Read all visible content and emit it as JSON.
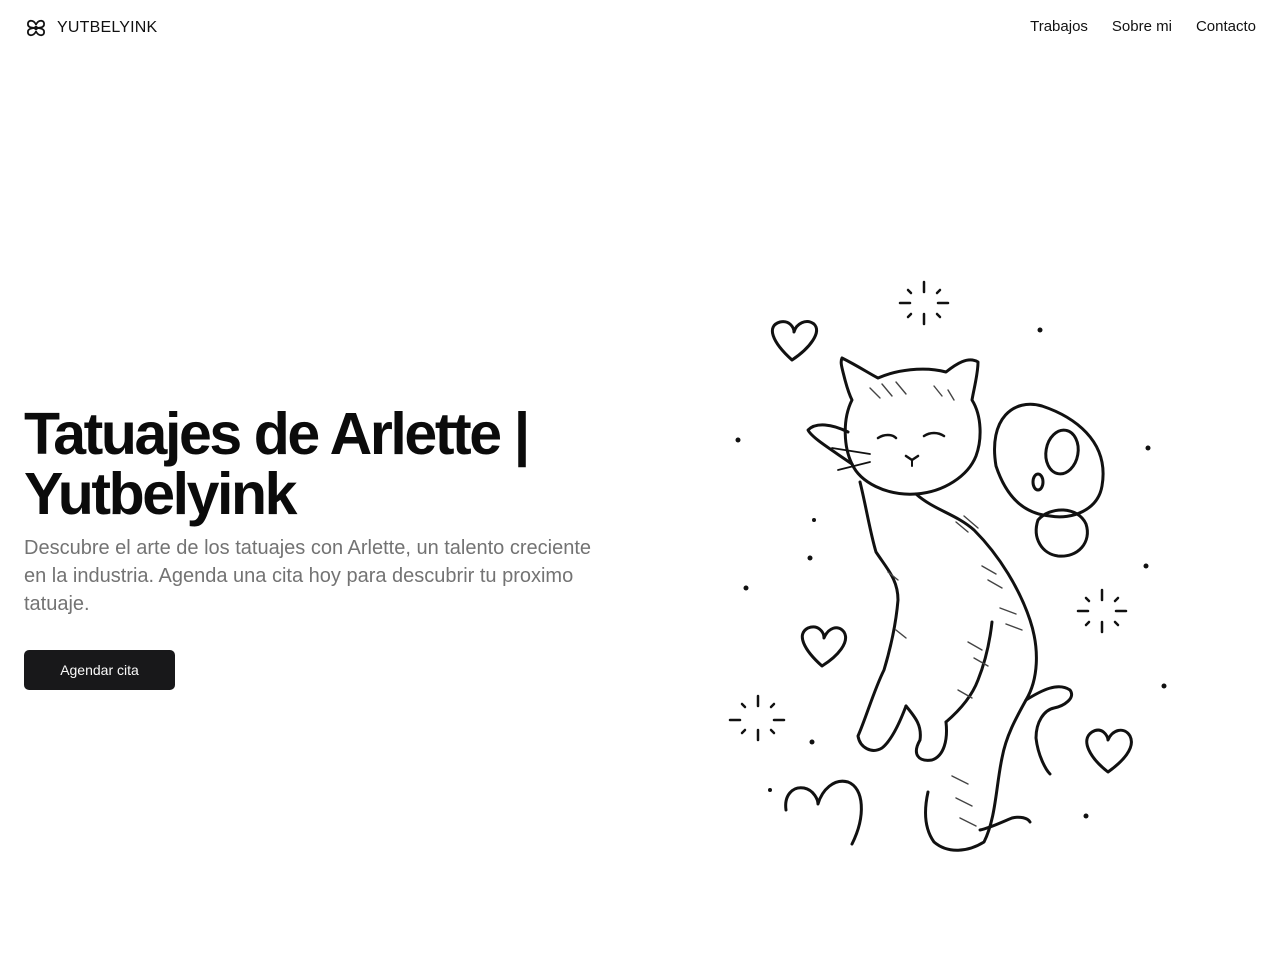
{
  "header": {
    "brand_name": "YUTBELYINK",
    "brand_icon": "flower-knot-icon",
    "nav": [
      {
        "label": "Trabajos"
      },
      {
        "label": "Sobre mi"
      },
      {
        "label": "Contacto"
      }
    ]
  },
  "hero": {
    "title_line1": "Tatuajes de Arlette |",
    "title_line2": "Yutbelyink",
    "description": "Descubre el arte de los tatuajes con Arlette, un talento creciente en la industria. Agenda una cita hoy para descubrir tu proximo tatuaje.",
    "cta_label": "Agendar cita",
    "cta_color": "#18181a",
    "image": "winged-cat-tattoo-illustration"
  }
}
